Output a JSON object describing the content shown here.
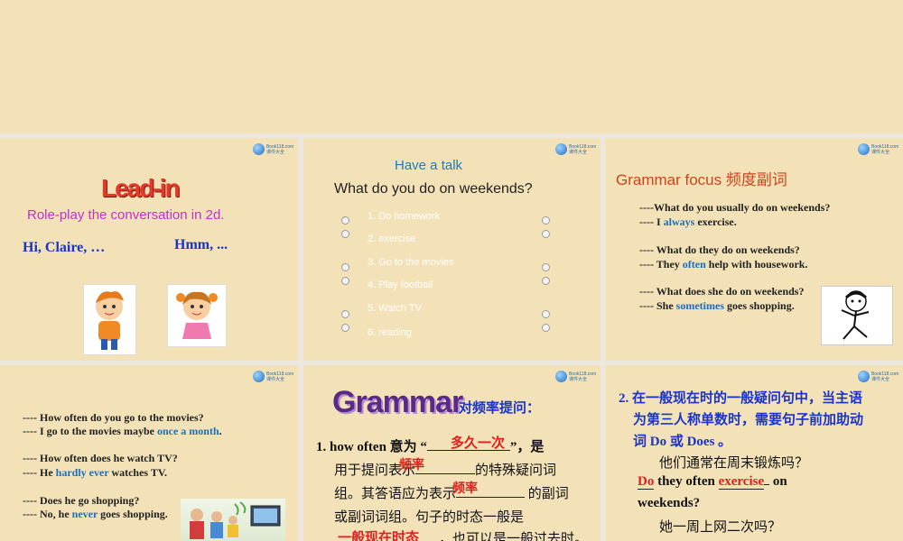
{
  "slide1": {
    "title": "Lead-in",
    "subtitle": "Role-play the conversation in 2d.",
    "line_left": "Hi, Claire, …",
    "line_right": "Hmm, ..."
  },
  "slide2": {
    "title": "Have a talk",
    "question": "What do you do on weekends?",
    "items": [
      "1. Do homework",
      "2. exercise",
      "3. Go to the movies",
      "4. Play football",
      "5. Watch TV",
      "6. reading"
    ]
  },
  "slide3": {
    "title": "Grammar focus 频度副词",
    "lines": [
      {
        "pre": "----What do you usually do on weekends?",
        "adv": "",
        "post": ""
      },
      {
        "pre": "---- I ",
        "adv": "always",
        "post": " exercise."
      },
      {
        "pre": "---- What do they do on weekends?",
        "adv": "",
        "post": ""
      },
      {
        "pre": "---- They ",
        "adv": "often",
        "post": " help with housework."
      },
      {
        "pre": "---- What does she do on weekends?",
        "adv": "",
        "post": ""
      },
      {
        "pre": "---- She ",
        "adv": "sometimes",
        "post": " goes shopping."
      }
    ]
  },
  "slide4": {
    "lines": [
      {
        "pre": "---- How often do you go to the movies?",
        "adv": "",
        "post": ""
      },
      {
        "pre": "---- I go to the movies maybe ",
        "adv": "once a month",
        "post": "."
      },
      {
        "pre": "---- How often does he watch TV?",
        "adv": "",
        "post": ""
      },
      {
        "pre": "---- He ",
        "adv": "hardly ever",
        "post": " watches TV."
      },
      {
        "pre": "---- Does he go shopping?",
        "adv": "",
        "post": ""
      },
      {
        "pre": "---- No, he ",
        "adv": "never",
        "post": " goes shopping."
      }
    ]
  },
  "slide5": {
    "title": "Grammar",
    "heading": "对频率提问：",
    "p1_a": "1. how often  意为  “",
    "p1_b": "”，是",
    "fill_1": "多久一次",
    "p2_a": "用于提问表示",
    "p2_b": "的特殊疑问词",
    "fill_2": "频率",
    "p3_a": "组。其答语应为表示",
    "p3_b": " 的副词",
    "fill_3": "频率",
    "p4": "或副词词组。句子的时态一般是",
    "fill_4": "一般现在时态",
    "p5_b": "，也可以是一般过去时。"
  },
  "slide6": {
    "rule_1": "2.  在一般现在时的一般疑问句中，当主语",
    "rule_2": "为第三人称单数时，需要句子前加助动",
    "rule_3": "词 Do 或 Does  。",
    "q1": "他们通常在周末锻炼吗？",
    "fill_do": "Do",
    "mid": " they often ",
    "fill_exercise": "exercise",
    "on": " on",
    "weekends": "weekends?",
    "q2": "她一周上网二次吗？"
  },
  "colors": {
    "background": "#f3e2b7",
    "accent_blue": "#1a6ec0",
    "answer_red": "#e02020",
    "title_purple": "#5b2a86",
    "talk_blue": "#1b7cc4",
    "grammar_orange": "#d2421a"
  }
}
